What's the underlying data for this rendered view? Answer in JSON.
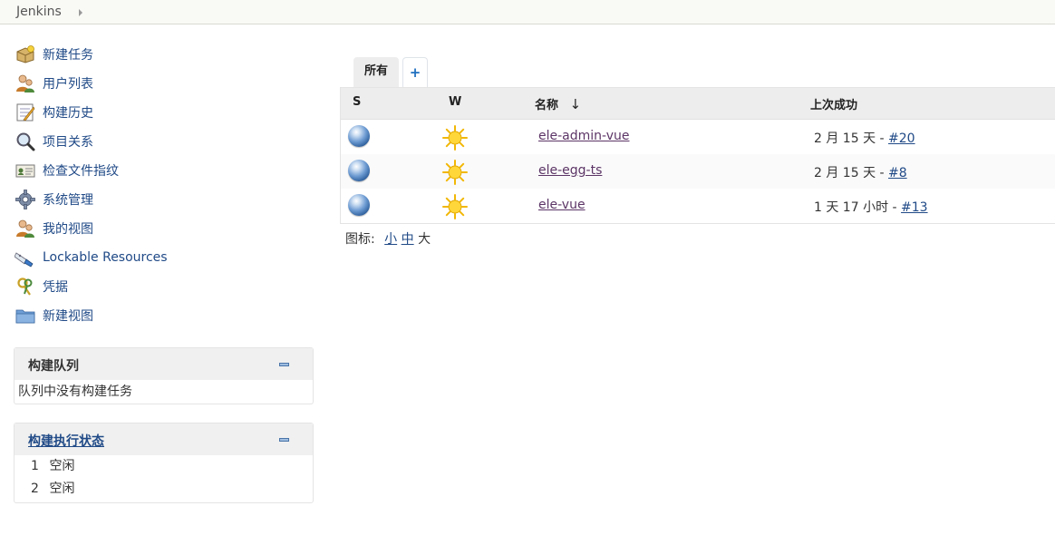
{
  "breadcrumb": {
    "root": "Jenkins"
  },
  "tasks": [
    {
      "label": "新建任务",
      "icon": "new-package-icon"
    },
    {
      "label": "用户列表",
      "icon": "user-icon"
    },
    {
      "label": "构建历史",
      "icon": "notepad-icon"
    },
    {
      "label": "项目关系",
      "icon": "magnifier-icon"
    },
    {
      "label": "检查文件指纹",
      "icon": "fingerprint-icon"
    },
    {
      "label": "系统管理",
      "icon": "gear-icon"
    },
    {
      "label": "我的视图",
      "icon": "user-icon"
    },
    {
      "label": "Lockable Resources",
      "icon": "usb-icon"
    },
    {
      "label": "凭据",
      "icon": "keys-icon"
    },
    {
      "label": "新建视图",
      "icon": "folder-icon"
    }
  ],
  "build_queue": {
    "title": "构建队列",
    "empty_text": "队列中没有构建任务"
  },
  "executors": {
    "title": "构建执行状态",
    "items": [
      {
        "num": "1",
        "state": "空闲"
      },
      {
        "num": "2",
        "state": "空闲"
      }
    ]
  },
  "tabs": {
    "all": "所有",
    "add": "+"
  },
  "table": {
    "headers": {
      "status": "S",
      "weather": "W",
      "name": "名称",
      "sort_arrow": "↓",
      "last_success": "上次成功"
    },
    "rows": [
      {
        "name": "ele-admin-vue",
        "since": "2 月 15 天 - ",
        "build": "#20"
      },
      {
        "name": "ele-egg-ts",
        "since": "2 月 15 天 - ",
        "build": "#8"
      },
      {
        "name": "ele-vue",
        "since": "1 天 17 小时 - ",
        "build": "#13"
      }
    ]
  },
  "icon_sizes": {
    "label": "图标:",
    "small": "小",
    "medium": "中",
    "large": "大"
  }
}
